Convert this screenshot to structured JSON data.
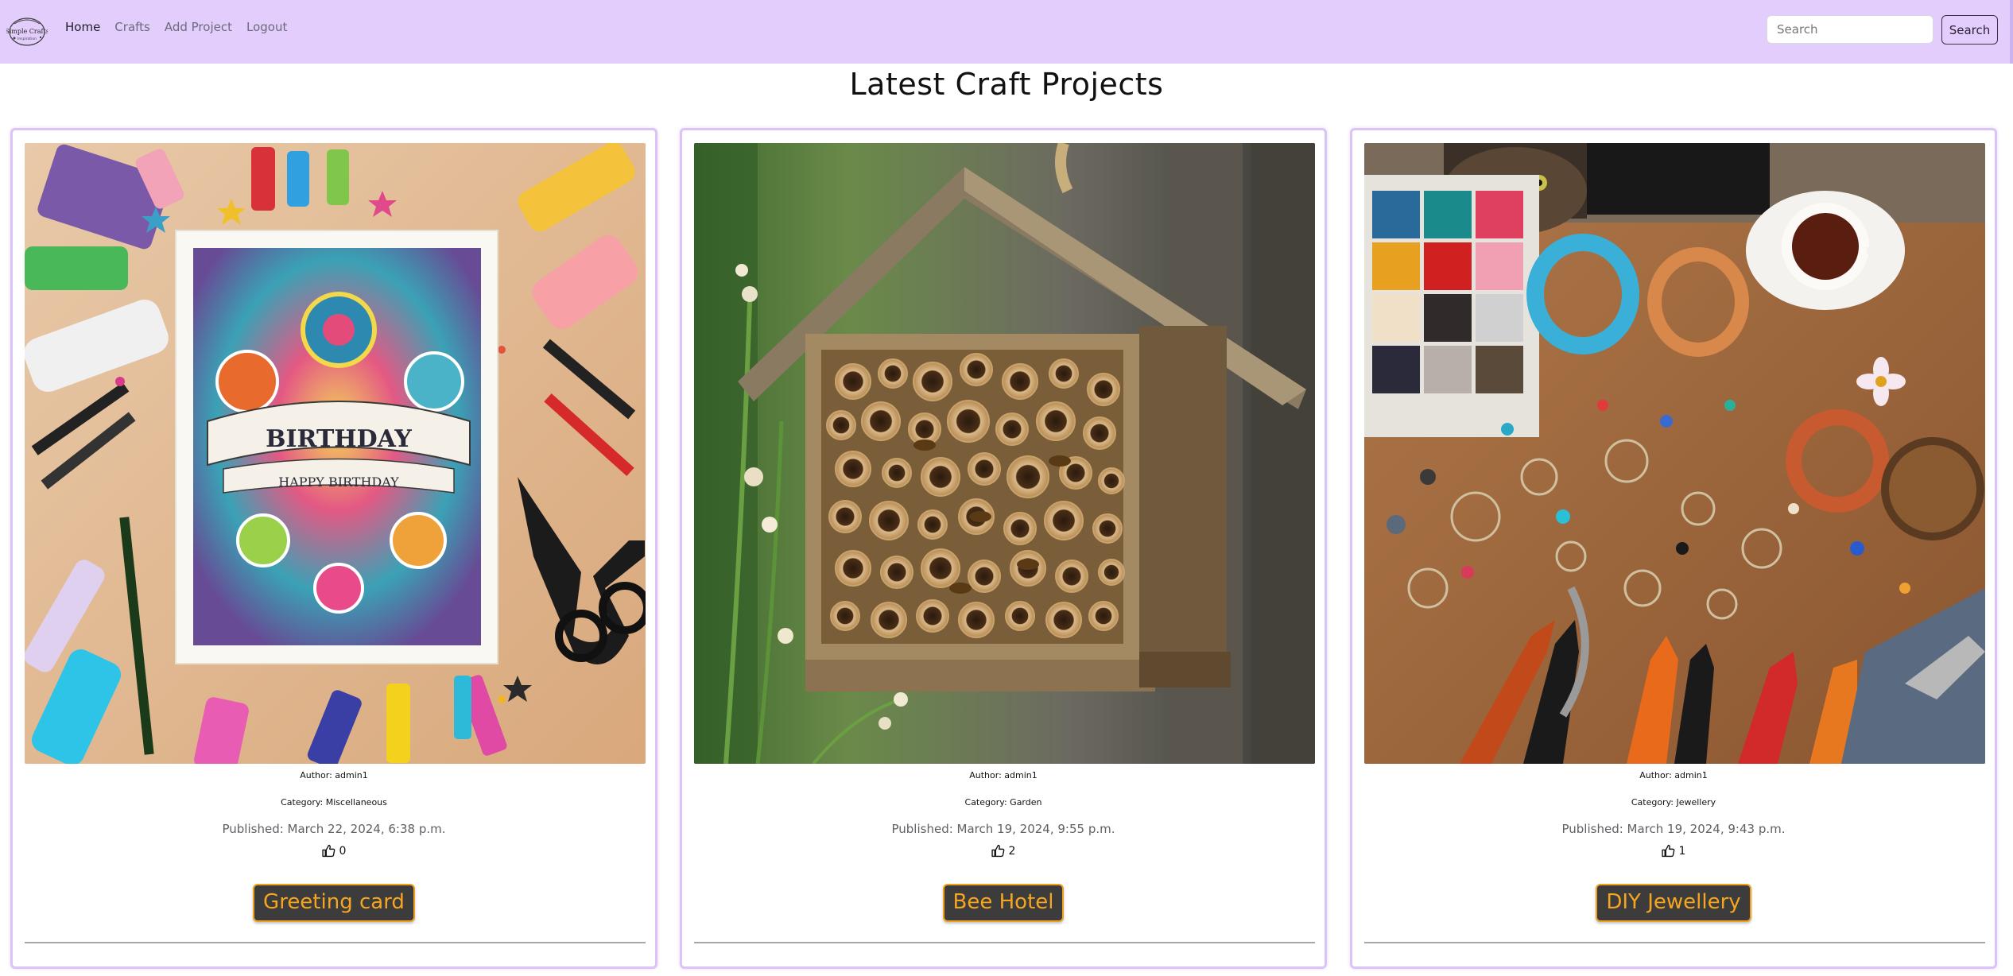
{
  "brand": {
    "logo_text": "Simple Crafts",
    "logo_tagline": "Inspiration"
  },
  "nav": {
    "items": [
      {
        "label": "Home",
        "active": true
      },
      {
        "label": "Crafts",
        "active": false
      },
      {
        "label": "Add Project",
        "active": false
      },
      {
        "label": "Logout",
        "active": false
      }
    ]
  },
  "search": {
    "placeholder": "Search",
    "value": "",
    "button_label": "Search"
  },
  "page": {
    "title": "Latest Craft Projects"
  },
  "colors": {
    "navbar_bg": "#e2cdfc",
    "card_border": "#dcc3f7",
    "title_button_bg": "#3c3c3c",
    "title_button_text": "#f6a51f"
  },
  "projects": [
    {
      "image_subject": "greeting-card-craft-image",
      "author": "Author: admin1",
      "category": "Category: Miscellaneous",
      "published": "Published: March 22, 2024, 6:38 p.m.",
      "likes": "0",
      "title": "Greeting card",
      "card_text_1": "BIRTHDAY",
      "card_text_2": "HAPPY BIRTHDAY"
    },
    {
      "image_subject": "bee-hotel-image",
      "author": "Author: admin1",
      "category": "Category: Garden",
      "published": "Published: March 19, 2024, 9:55 p.m.",
      "likes": "2",
      "title": "Bee Hotel"
    },
    {
      "image_subject": "jewellery-making-image",
      "author": "Author: admin1",
      "category": "Category: Jewellery",
      "published": "Published: March 19, 2024, 9:43 p.m.",
      "likes": "1",
      "title": "DIY Jewellery"
    }
  ]
}
